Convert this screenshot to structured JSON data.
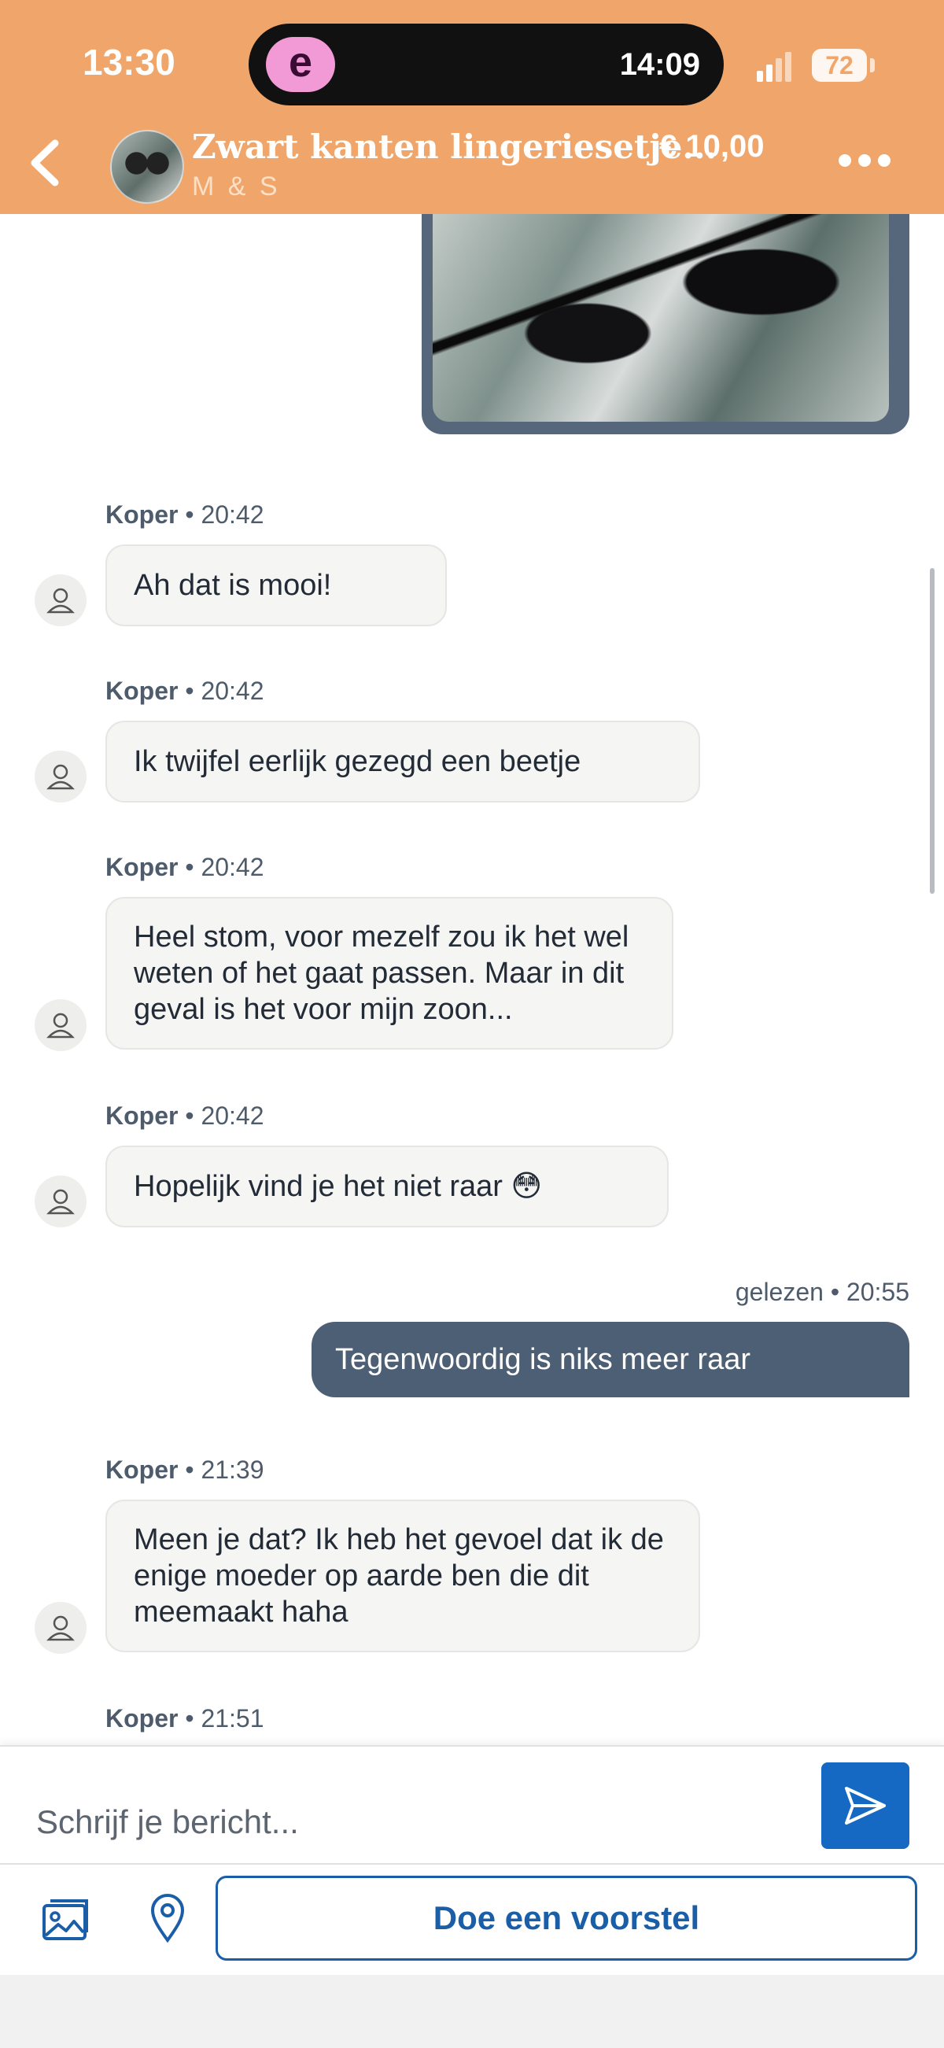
{
  "status_bar": {
    "time": "13:30",
    "island_app_letter": "e",
    "island_time": "14:09",
    "battery": "72"
  },
  "header": {
    "title": "Zwart kanten lingeriesetje...",
    "subtitle": "M & S",
    "price": "€ 10,00"
  },
  "messages": [
    {
      "sender": "Koper",
      "time": "20:42",
      "text": "Ah dat is mooi!"
    },
    {
      "sender": "Koper",
      "time": "20:42",
      "text": "Ik twijfel eerlijk gezegd een beetje"
    },
    {
      "sender": "Koper",
      "time": "20:42",
      "text": "Heel stom, voor mezelf zou ik het wel\nweten of het gaat passen. Maar in dit\ngeval is het voor mijn zoon..."
    },
    {
      "sender": "Koper",
      "time": "20:42",
      "text": "Hopelijk vind je het niet raar 😳"
    },
    {
      "sender": "Koper",
      "time": "21:39",
      "text": "Meen je dat? Ik heb het gevoel dat ik de\nenige moeder op aarde ben die dit\nmeemaakt haha"
    },
    {
      "sender": "Koper",
      "time": "21:51",
      "text": ""
    }
  ],
  "outgoing": {
    "status": "gelezen",
    "time": "20:55",
    "text": "Tegenwoordig is niks meer raar"
  },
  "meta_separator": "•",
  "composer": {
    "placeholder": "Schrijf je bericht...",
    "offer_label": "Doe een voorstel"
  },
  "colors": {
    "header": "#f0a66a",
    "primary_blue": "#1669c2",
    "outgoing_bubble": "#4c5f74",
    "incoming_bubble": "#f5f5f4"
  }
}
